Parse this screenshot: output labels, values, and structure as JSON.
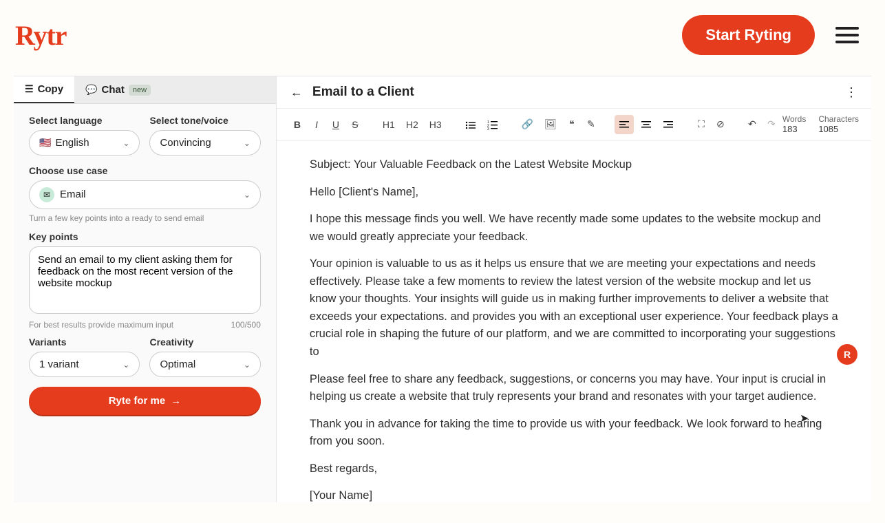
{
  "header": {
    "logo_text": "Rytr",
    "start_button": "Start Ryting"
  },
  "sidebar": {
    "tabs": {
      "copy": "Copy",
      "chat": "Chat",
      "chat_badge": "new"
    },
    "language_label": "Select language",
    "language_value": "English",
    "language_flag": "🇺🇸",
    "tone_label": "Select tone/voice",
    "tone_value": "Convincing",
    "usecase_label": "Choose use case",
    "usecase_value": "Email",
    "usecase_helper": "Turn a few key points into a ready to send email",
    "keypoints_label": "Key points",
    "keypoints_value": "Send an email to my client asking them for feedback on the most recent version of the website mockup",
    "keypoints_helper": "For best results provide maximum input",
    "keypoints_counter": "100/500",
    "variants_label": "Variants",
    "variants_value": "1 variant",
    "creativity_label": "Creativity",
    "creativity_value": "Optimal",
    "ryte_button": "Ryte for me"
  },
  "editor": {
    "title": "Email to a Client",
    "stats": {
      "words_label": "Words",
      "words_value": "183",
      "chars_label": "Characters",
      "chars_value": "1085"
    },
    "body": {
      "p1": "Subject: Your Valuable Feedback on the Latest Website Mockup",
      "p2": "Hello [Client's Name],",
      "p3": "I hope this message finds you well. We have recently made some updates to the website mockup and we would greatly appreciate your feedback.",
      "p4": "Your opinion is valuable to us as it helps us ensure that we are meeting your expectations and needs effectively. Please take a few moments to review the latest version of the website mockup and let us know your thoughts. Your insights will guide us in making further improvements to deliver a website that exceeds your expectations. and provides you with an exceptional user experience. Your feedback plays a crucial role in shaping the future of our platform, and we are committed to incorporating your suggestions to",
      "p5": "Please feel free to share any feedback, suggestions, or concerns you may have. Your input is crucial in helping us create a website that truly represents your brand and resonates with your target audience.",
      "p6": "Thank you in advance for taking the time to provide us with your feedback. We look forward to hearing from you soon.",
      "p7": "Best regards,",
      "p8": "[Your Name]"
    }
  },
  "toolbar": {
    "bold": "B",
    "italic": "I",
    "underline": "U",
    "strike": "S",
    "h1": "H1",
    "h2": "H2",
    "h3": "H3"
  },
  "float_badge": "R"
}
